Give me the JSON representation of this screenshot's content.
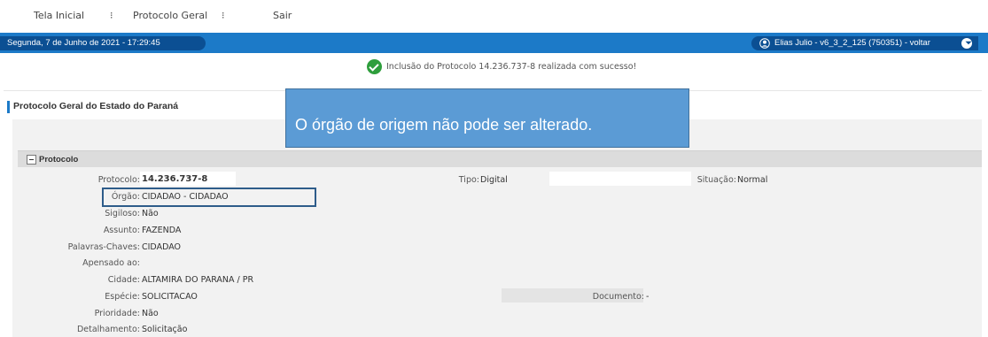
{
  "nav": {
    "items": [
      "Tela Inicial",
      "Protocolo Geral",
      "Sair"
    ],
    "separator": "⁝"
  },
  "header": {
    "date": "Segunda, 7 de Junho de 2021 - 17:29:45",
    "user": "Elias Julio - v6_3_2_125 (750351) - voltar",
    "accent": "#1c7ac8",
    "dark_accent": "#0b4f93"
  },
  "alert": {
    "message": "Inclusão do Protocolo 14.236.737-8 realizada com sucesso!",
    "color": "#2e9e3c"
  },
  "page": {
    "title": "Protocolo Geral do Estado do Paraná"
  },
  "tooltip": {
    "text": "O órgão de origem não pode ser alterado."
  },
  "section": {
    "title": "Protocolo"
  },
  "fields": {
    "protocolo": {
      "label": "Protocolo:",
      "value": "14.236.737-8"
    },
    "tipo": {
      "label": "Tipo:",
      "value": "Digital"
    },
    "situacao": {
      "label": "Situação:",
      "value": "Normal"
    },
    "orgao": {
      "label": "Órgão:",
      "value": "CIDADAO - CIDADAO"
    },
    "sigiloso": {
      "label": "Sigiloso:",
      "value": "Não"
    },
    "assunto": {
      "label": "Assunto:",
      "value": "FAZENDA"
    },
    "palavras": {
      "label": "Palavras-Chaves:",
      "value": "CIDADAO"
    },
    "apensado": {
      "label": "Apensado ao:",
      "value": ""
    },
    "cidade": {
      "label": "Cidade:",
      "value": "ALTAMIRA DO PARANA / PR"
    },
    "especie": {
      "label": "Espécie:",
      "value": "SOLICITACAO"
    },
    "documento": {
      "label": "Documento:",
      "value": "-"
    },
    "prioridade": {
      "label": "Prioridade:",
      "value": "Não"
    },
    "detalhamento": {
      "label": "Detalhamento:",
      "value": "Solicitação"
    }
  }
}
